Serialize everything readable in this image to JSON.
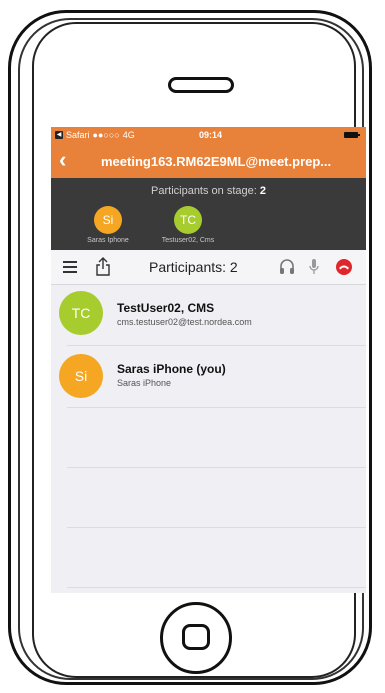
{
  "status_bar": {
    "carrier": "Safari",
    "signal": "●●○○○",
    "network": "4G",
    "time": "09:14"
  },
  "nav": {
    "back_symbol": "‹",
    "title": "meeting163.RM62E9ML@meet.prep..."
  },
  "stage": {
    "label": "Participants on stage: ",
    "count": "2",
    "participants": [
      {
        "initials": "Si",
        "name": "Saras Iphone",
        "color": "#f5a623"
      },
      {
        "initials": "TC",
        "name": "Testuser02, Cms",
        "color": "#a6cc2e"
      }
    ]
  },
  "toolbar": {
    "title": "Participants: 2",
    "icons": [
      "menu-icon",
      "share-icon",
      "headset-icon",
      "microphone-icon",
      "hangup-icon"
    ]
  },
  "participants": [
    {
      "initials": "TC",
      "name": "TestUser02, CMS",
      "detail": "cms.testuser02@test.nordea.com",
      "color": "#a6cc2e"
    },
    {
      "initials": "Si",
      "name": "Saras iPhone (you)",
      "detail": "Saras iPhone",
      "color": "#f5a623"
    }
  ],
  "colors": {
    "accent": "#e8823a",
    "stage_bg": "#3a3a3a",
    "hangup": "#e0262b"
  }
}
